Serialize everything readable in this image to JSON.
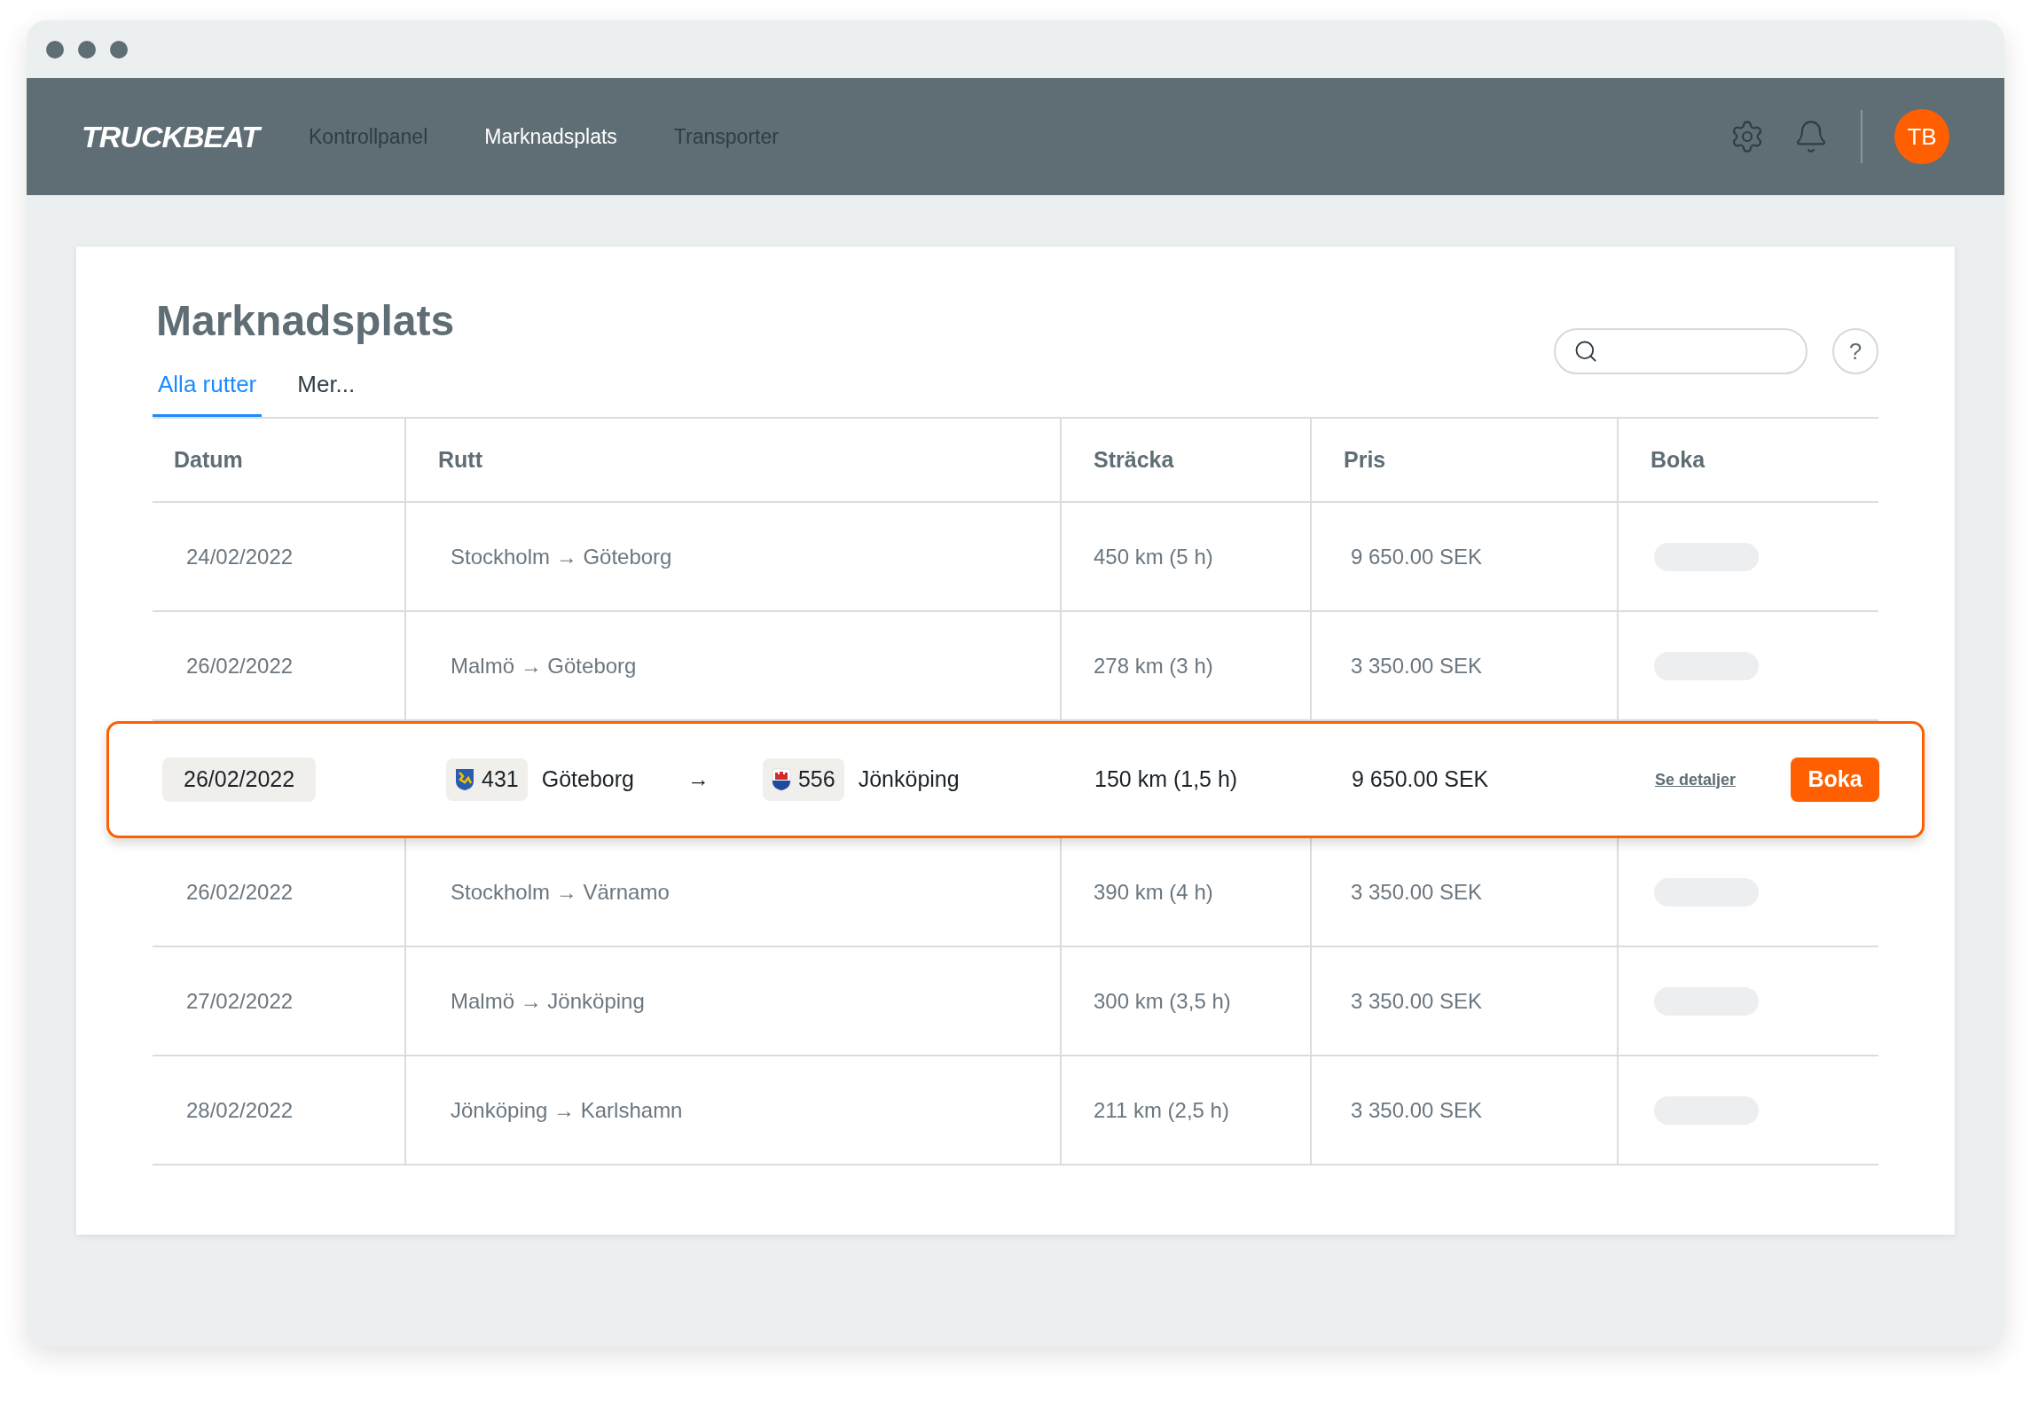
{
  "app": {
    "logo": "TRUCKBEAT",
    "nav": [
      {
        "label": "Kontrollpanel",
        "selected": false
      },
      {
        "label": "Marknadsplats",
        "selected": true
      },
      {
        "label": "Transporter",
        "selected": false
      }
    ],
    "avatar": "TB"
  },
  "page": {
    "title": "Marknadsplats",
    "tabs": [
      {
        "label": "Alla rutter",
        "selected": true
      },
      {
        "label": "Mer...",
        "selected": false
      }
    ],
    "help": "?"
  },
  "table": {
    "columns": [
      "Datum",
      "Rutt",
      "Sträcka",
      "Pris",
      "Boka"
    ],
    "rows": [
      {
        "kind": "summary",
        "date": "24/02/2022",
        "route": "Stockholm → Göteborg",
        "distance": "450 km (5 h)",
        "price": "9 650.00 SEK"
      },
      {
        "kind": "summary",
        "date": "26/02/2022",
        "route": "Malmö → Göteborg",
        "distance": "278 km (3 h)",
        "price": "3 350.00 SEK"
      },
      {
        "kind": "detail",
        "date": "26/02/2022",
        "from": {
          "code": "431",
          "city": "Göteborg"
        },
        "arrow": "→",
        "to": {
          "code": "556",
          "city": "Jönköping"
        },
        "distance": "150 km (1,5 h)",
        "price": "9 650.00 SEK",
        "details_link": "Se detaljer",
        "book_button": "Boka"
      },
      {
        "kind": "summary",
        "date": "26/02/2022",
        "route": "Stockholm → Värnamo",
        "distance": "390 km (4 h)",
        "price": "3 350.00 SEK"
      },
      {
        "kind": "summary",
        "date": "27/02/2022",
        "route": "Malmö → Jönköping",
        "distance": "300 km (3,5 h)",
        "price": "3 350.00 SEK"
      },
      {
        "kind": "summary",
        "date": "28/02/2022",
        "route": "Jönköping → Karlshamn",
        "distance": "211 km (2,5 h)",
        "price": "3 350.00 SEK"
      }
    ]
  }
}
